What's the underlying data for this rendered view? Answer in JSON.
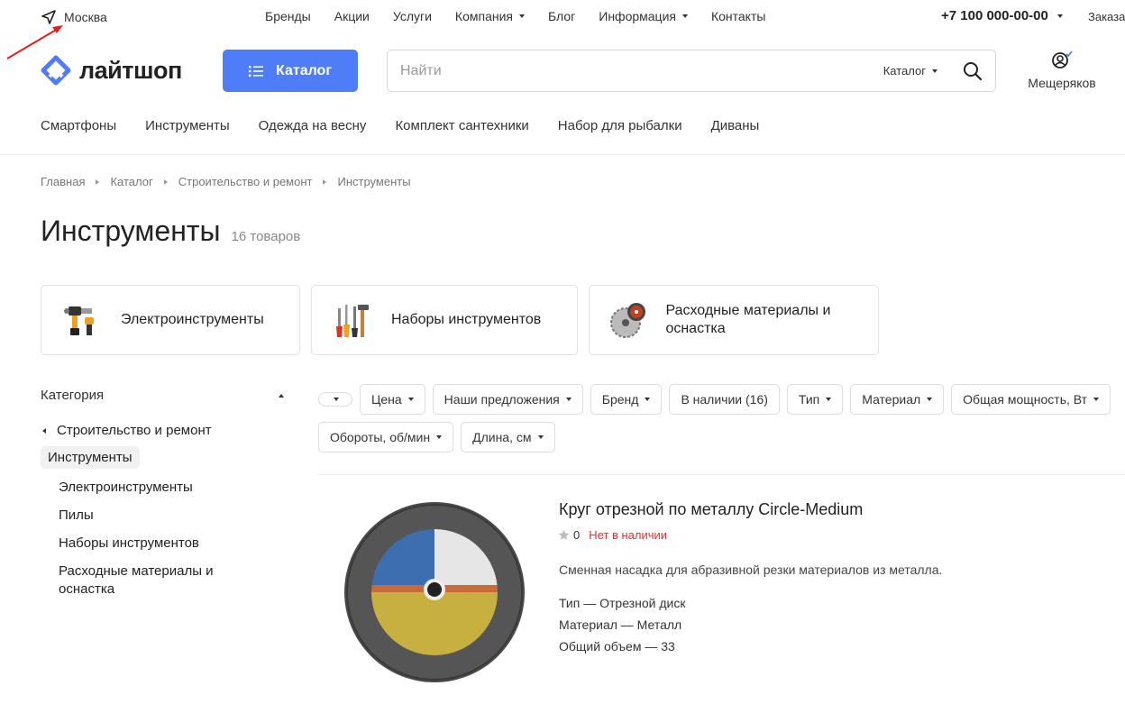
{
  "topbar": {
    "city": "Москва",
    "nav": [
      {
        "label": "Бренды",
        "dropdown": false
      },
      {
        "label": "Акции",
        "dropdown": false
      },
      {
        "label": "Услуги",
        "dropdown": false
      },
      {
        "label": "Компания",
        "dropdown": true
      },
      {
        "label": "Блог",
        "dropdown": false
      },
      {
        "label": "Информация",
        "dropdown": true
      },
      {
        "label": "Контакты",
        "dropdown": false
      }
    ],
    "phone": "+7 100 000-00-00",
    "order": "Заказа"
  },
  "header": {
    "logo": "лайтшоп",
    "catalog_button": "Каталог",
    "search_placeholder": "Найти",
    "search_category": "Каталог",
    "user_name": "Мещеряков"
  },
  "quicknav": [
    "Смартфоны",
    "Инструменты",
    "Одежда на весну",
    "Комплект сантехники",
    "Набор для рыбалки",
    "Диваны"
  ],
  "breadcrumb": [
    "Главная",
    "Каталог",
    "Строительство и ремонт",
    "Инструменты"
  ],
  "page": {
    "title": "Инструменты",
    "count": "16 товаров"
  },
  "categories": [
    {
      "label": "Электроинструменты",
      "icon": "power-tools-icon"
    },
    {
      "label": "Наборы инструментов",
      "icon": "toolset-icon"
    },
    {
      "label": "Расходные материалы и оснастка",
      "icon": "saw-blade-icon"
    }
  ],
  "sidebar": {
    "heading": "Категория",
    "parent": "Строительство и ремонт",
    "active": "Инструменты",
    "items": [
      "Электроинструменты",
      "Пилы",
      "Наборы инструментов",
      "Расходные материалы и оснастка"
    ]
  },
  "filters": [
    "Цена",
    "Наши предложения",
    "Бренд",
    "В наличии (16)",
    "Тип",
    "Материал",
    "Общая мощность, Вт",
    "Обороты, об/мин",
    "Длина, см"
  ],
  "product": {
    "title": "Круг отрезной по металлу Circle-Medium",
    "rating": "0",
    "stock": "Нет в наличии",
    "description": "Сменная насадка для абразивной резки материалов из металла.",
    "properties": [
      "Тип — Отрезной диск",
      "Материал — Металл",
      "Общий объем — 33"
    ]
  },
  "colors": {
    "accent": "#4f7cf7",
    "out_of_stock": "#e0302d"
  }
}
